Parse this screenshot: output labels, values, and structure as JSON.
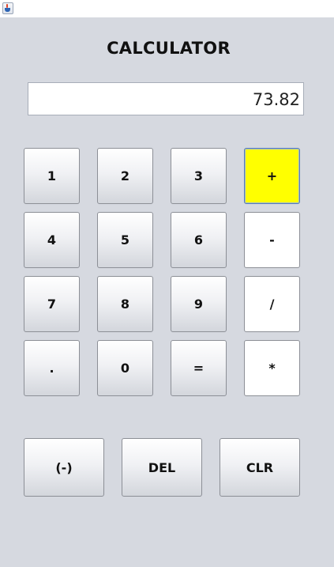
{
  "window": {
    "icon": "java-cup-icon"
  },
  "app": {
    "title": "CALCULATOR"
  },
  "display": {
    "value": "73.82"
  },
  "keypad": {
    "k1": "1",
    "k2": "2",
    "k3": "3",
    "plus": "+",
    "k4": "4",
    "k5": "5",
    "k6": "6",
    "minus": "-",
    "k7": "7",
    "k8": "8",
    "k9": "9",
    "divide": "/",
    "decimal": ".",
    "k0": "0",
    "equals": "=",
    "multiply": "*"
  },
  "functions": {
    "negate": "(-)",
    "delete": "DEL",
    "clear": "CLR"
  },
  "colors": {
    "background": "#d6d9e0",
    "active_operator": "#ffff00",
    "operator_button": "#ffffff"
  },
  "state": {
    "active_operator": "+"
  }
}
